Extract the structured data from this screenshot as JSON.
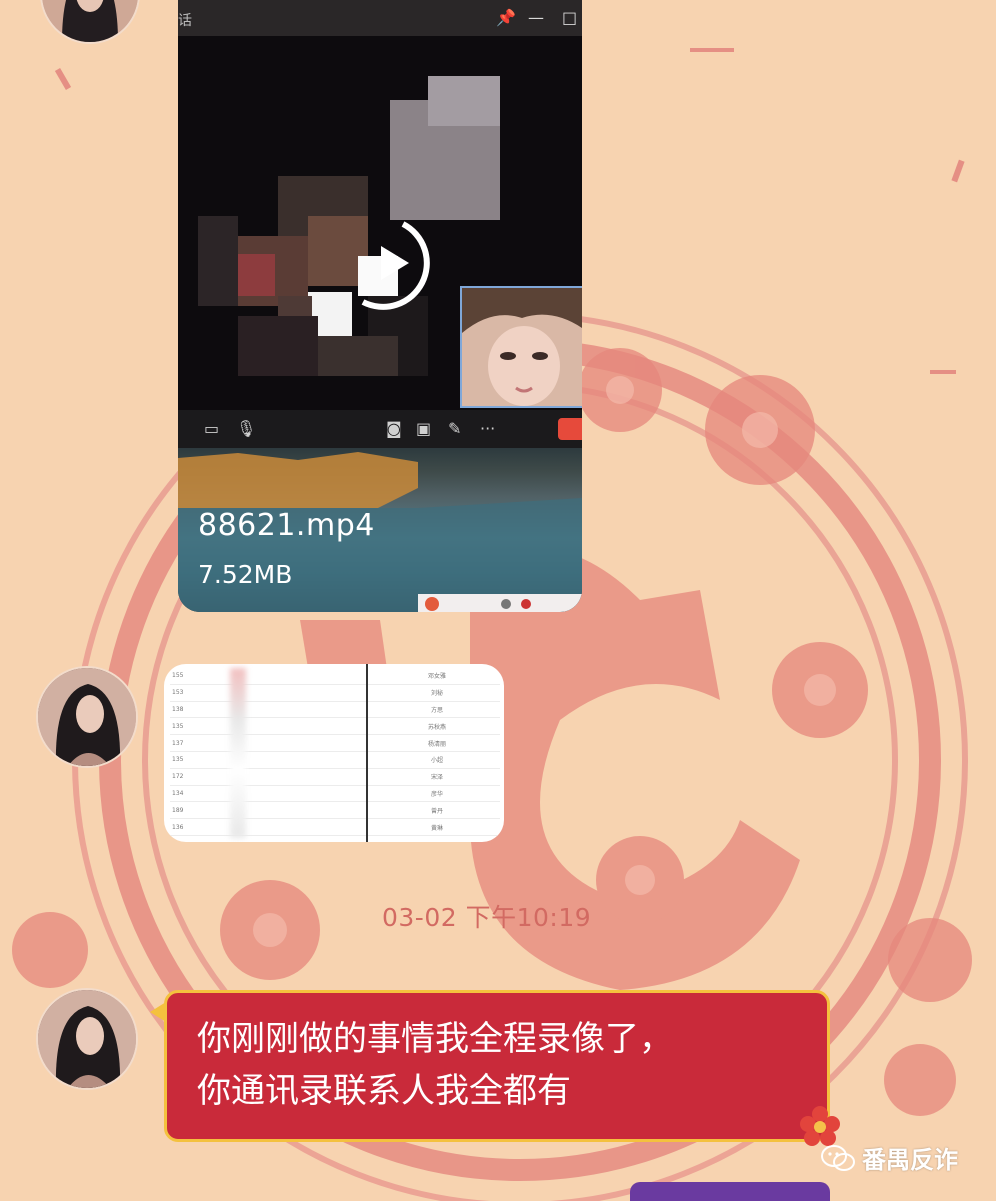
{
  "video_message": {
    "window_title": "话",
    "file_name": "88621.mp4",
    "file_size": "7.52MB"
  },
  "contacts_table": {
    "rows": [
      {
        "number": "155",
        "name": "邓女雅"
      },
      {
        "number": "153",
        "name": "刘秘"
      },
      {
        "number": "138",
        "name": "方思"
      },
      {
        "number": "135",
        "name": "苏秋燕"
      },
      {
        "number": "137",
        "name": "杨清丽"
      },
      {
        "number": "135",
        "name": "小超"
      },
      {
        "number": "172",
        "name": "宋泽"
      },
      {
        "number": "134",
        "name": "彦华"
      },
      {
        "number": "189",
        "name": "曾丹"
      },
      {
        "number": "136",
        "name": "黄琳"
      }
    ]
  },
  "timestamp": "03-02 下午10:19",
  "message": {
    "line1": "你刚刚做的事情我全程录像了，",
    "line2": "你通讯录联系人我全都有"
  },
  "watermark": {
    "text": "番禺反诈",
    "icon": "wechat-icon"
  },
  "colors": {
    "background": "#f7d3b0",
    "papercut": "#e37f74",
    "bubble_red": "#c92a3a",
    "bubble_border": "#f4c13e",
    "timestamp": "#d26a62"
  }
}
